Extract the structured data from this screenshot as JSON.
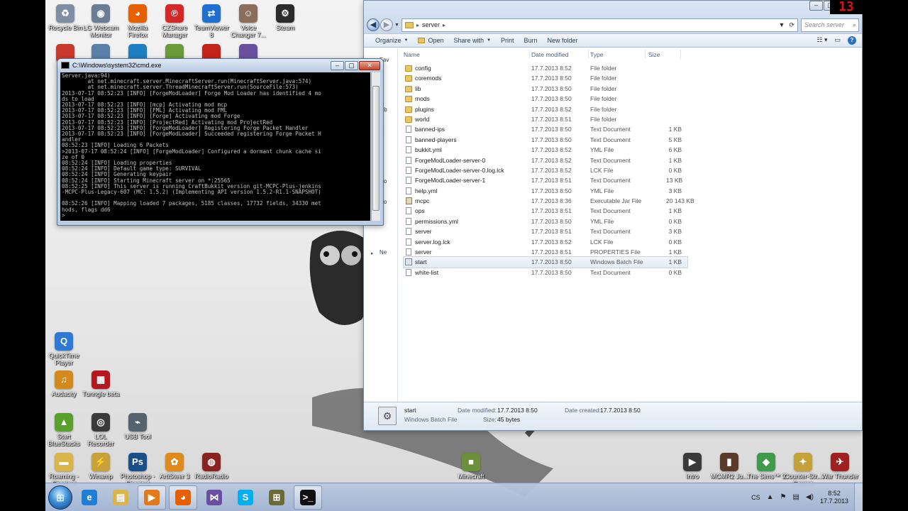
{
  "desktop": {
    "icons_top_row": [
      {
        "label": "Recycle Bin",
        "icon": "recycle-bin-icon",
        "color": "#7f8fa3",
        "glyph": "♻"
      },
      {
        "label": "LG Webcam Monitor",
        "icon": "webcam-icon",
        "color": "#6b7d92",
        "glyph": "◉"
      },
      {
        "label": "Mozilla Firefox",
        "icon": "firefox-icon",
        "color": "#e66000",
        "glyph": "◕"
      },
      {
        "label": "CZShare Manager",
        "icon": "czshare-icon",
        "color": "#d62727",
        "glyph": "℗"
      },
      {
        "label": "TeamViewer 8",
        "icon": "teamviewer-icon",
        "color": "#1f6fd1",
        "glyph": "⇄"
      },
      {
        "label": "Voice Changer 7...",
        "icon": "voice-changer-icon",
        "color": "#8a6d5a",
        "glyph": "☺"
      },
      {
        "label": "Steam",
        "icon": "steam-icon",
        "color": "#2b2b2b",
        "glyph": "⚙"
      }
    ],
    "icons_second_row": [
      {
        "icon": "app-icon-1",
        "color": "#c93a2c"
      },
      {
        "icon": "app-icon-2",
        "color": "#5a7fa8"
      },
      {
        "icon": "app-icon-3",
        "color": "#1f7fc2"
      },
      {
        "icon": "app-icon-4",
        "color": "#6a9a3a"
      },
      {
        "icon": "acrobat-icon",
        "color": "#c4221b"
      },
      {
        "icon": "visual-studio-icon",
        "color": "#6a4fa0"
      }
    ],
    "icons_left": [
      {
        "label": "QuickTime Player",
        "icon": "quicktime-icon",
        "color": "#2d7ad6",
        "glyph": "Q"
      },
      {
        "label": "Audacity",
        "icon": "audacity-icon",
        "color": "#d48a1a",
        "glyph": "♫"
      },
      {
        "label": "Tunngle beta",
        "icon": "tunngle-icon",
        "color": "#b5181e",
        "glyph": "▦"
      },
      {
        "label": "Start BlueStacks",
        "icon": "bluestacks-icon",
        "color": "#5aa02c",
        "glyph": "▲"
      },
      {
        "label": "LOL Recorder",
        "icon": "lol-recorder-icon",
        "color": "#3a3a3a",
        "glyph": "◎"
      },
      {
        "label": "USB Tool",
        "icon": "usb-tool-icon",
        "color": "#55636f",
        "glyph": "⌁"
      },
      {
        "label": "Roaming - Shortcut",
        "icon": "folder-shortcut-icon",
        "color": "#d9b54a",
        "glyph": "▬"
      },
      {
        "label": "Winamp",
        "icon": "winamp-icon",
        "color": "#c7a13a",
        "glyph": "⚡"
      },
      {
        "label": "Photoshop - Shortcut",
        "icon": "photoshop-icon",
        "color": "#1b4f8a",
        "glyph": "Ps"
      },
      {
        "label": "ArtiSteer 3",
        "icon": "artisteer-icon",
        "color": "#e08a1c",
        "glyph": "✿"
      },
      {
        "label": "RadioRadio",
        "icon": "radio-icon",
        "color": "#8a2222",
        "glyph": "◍"
      },
      {
        "label": "Minecraft",
        "icon": "minecraft-icon",
        "color": "#6b8f3a",
        "glyph": "■"
      }
    ],
    "icons_right": [
      {
        "label": "Intro",
        "icon": "intro-icon",
        "color": "#3a3a3a",
        "glyph": "▶"
      },
      {
        "label": "MCMR2 Ju...",
        "icon": "mcmr-icon",
        "color": "#5a3a2a",
        "glyph": "▮"
      },
      {
        "label": "The Sims™ 3",
        "icon": "sims-icon",
        "color": "#3f9b4a",
        "glyph": "◆"
      },
      {
        "label": "Counter-Str... Source",
        "icon": "counter-strike-icon",
        "color": "#c5a13a",
        "glyph": "✦"
      },
      {
        "label": "War Thunder",
        "icon": "war-thunder-icon",
        "color": "#a02020",
        "glyph": "✈"
      }
    ]
  },
  "clock_widget": {
    "value": "13",
    "color": "#dd1111"
  },
  "cmd": {
    "title": "C:\\Windows\\system32\\cmd.exe",
    "lines": [
      "Server.java:94)",
      "        at net.minecraft.server.MinecraftServer.run(MinecraftServer.java:574)",
      "        at net.minecraft.server.ThreadMinecraftServer.run(SourceFile:573)",
      "2013-07-17 08:52:23 [INFO] [ForgeModLoader] Forge Mod Loader has identified 4 mo",
      "ds to load",
      "2013-07-17 08:52:23 [INFO] [mcp] Activating mod mcp",
      "2013-07-17 08:52:23 [INFO] [FML] Activating mod FML",
      "2013-07-17 08:52:23 [INFO] [Forge] Activating mod Forge",
      "2013-07-17 08:52:23 [INFO] [ProjectRed] Activating mod ProjectRed",
      "2013-07-17 08:52:23 [INFO] [ForgeModLoader] Registering Forge Packet Handler",
      "2013-07-17 08:52:23 [INFO] [ForgeModLoader] Succeeded registering Forge Packet H",
      "andler",
      "08:52:23 [INFO] Loading 6 Packets",
      ">2013-07-17 08:52:24 [INFO] [ForgeModLoader] Configured a dormant chunk cache si",
      "ze of 0",
      "08:52:24 [INFO] Loading properties",
      "08:52:24 [INFO] Default game type: SURVIVAL",
      "08:52:24 [INFO] Generating keypair",
      "08:52:24 [INFO] Starting Minecraft server on *:25565",
      "08:52:25 [INFO] This server is running CraftBukkit version git-MCPC-Plus-jenkins",
      "-MCPC-Plus-Legacy-607 (MC: 1.5.2) (Implementing API version 1.5.2-R1.1-SNAPSHOT)",
      "",
      "08:52:26 [INFO] Mapping loaded 7 packages, 5185 classes, 17732 fields, 34330 met",
      "hods, flags dd6",
      ">"
    ]
  },
  "explorer": {
    "breadcrumb": "server",
    "search_placeholder": "Search server",
    "toolbar": {
      "organize": "Organize",
      "open": "Open",
      "share_with": "Share with",
      "print": "Print",
      "burn": "Burn",
      "new_folder": "New folder"
    },
    "nav_pane": [
      "Fav",
      "D",
      "D",
      "R",
      "Lib",
      "D",
      "M",
      "P",
      "V",
      "Ho",
      "Co",
      "L",
      "D",
      "Ne"
    ],
    "columns": {
      "name": "Name",
      "date": "Date modified",
      "type": "Type",
      "size": "Size"
    },
    "files": [
      {
        "name": "config",
        "date": "17.7.2013 8:52",
        "type": "File folder",
        "size": "",
        "kind": "folder"
      },
      {
        "name": "coremods",
        "date": "17.7.2013 8:50",
        "type": "File folder",
        "size": "",
        "kind": "folder"
      },
      {
        "name": "lib",
        "date": "17.7.2013 8:50",
        "type": "File folder",
        "size": "",
        "kind": "folder"
      },
      {
        "name": "mods",
        "date": "17.7.2013 8:50",
        "type": "File folder",
        "size": "",
        "kind": "folder"
      },
      {
        "name": "plugins",
        "date": "17.7.2013 8:52",
        "type": "File folder",
        "size": "",
        "kind": "folder"
      },
      {
        "name": "world",
        "date": "17.7.2013 8:51",
        "type": "File folder",
        "size": "",
        "kind": "folder"
      },
      {
        "name": "banned-ips",
        "date": "17.7.2013 8:50",
        "type": "Text Document",
        "size": "1 KB",
        "kind": "doc"
      },
      {
        "name": "banned-players",
        "date": "17.7.2013 8:50",
        "type": "Text Document",
        "size": "5 KB",
        "kind": "doc"
      },
      {
        "name": "bukkit.yml",
        "date": "17.7.2013 8:52",
        "type": "YML File",
        "size": "6 KB",
        "kind": "doc"
      },
      {
        "name": "ForgeModLoader-server-0",
        "date": "17.7.2013 8:52",
        "type": "Text Document",
        "size": "1 KB",
        "kind": "doc"
      },
      {
        "name": "ForgeModLoader-server-0.log.lck",
        "date": "17.7.2013 8:52",
        "type": "LCK File",
        "size": "0 KB",
        "kind": "doc"
      },
      {
        "name": "ForgeModLoader-server-1",
        "date": "17.7.2013 8:51",
        "type": "Text Document",
        "size": "13 KB",
        "kind": "doc"
      },
      {
        "name": "help.yml",
        "date": "17.7.2013 8:50",
        "type": "YML File",
        "size": "3 KB",
        "kind": "doc"
      },
      {
        "name": "mcpc",
        "date": "17.7.2013 8:36",
        "type": "Executable Jar File",
        "size": "20 143 KB",
        "kind": "jar"
      },
      {
        "name": "ops",
        "date": "17.7.2013 8:51",
        "type": "Text Document",
        "size": "1 KB",
        "kind": "doc"
      },
      {
        "name": "permissions.yml",
        "date": "17.7.2013 8:50",
        "type": "YML File",
        "size": "0 KB",
        "kind": "doc"
      },
      {
        "name": "server",
        "date": "17.7.2013 8:51",
        "type": "Text Document",
        "size": "3 KB",
        "kind": "doc"
      },
      {
        "name": "server.log.lck",
        "date": "17.7.2013 8:52",
        "type": "LCK File",
        "size": "0 KB",
        "kind": "doc"
      },
      {
        "name": "server",
        "date": "17.7.2013 8:51",
        "type": "PROPERTIES File",
        "size": "1 KB",
        "kind": "doc"
      },
      {
        "name": "start",
        "date": "17.7.2013 8:50",
        "type": "Windows Batch File",
        "size": "1 KB",
        "kind": "bat",
        "selected": true
      },
      {
        "name": "white-list",
        "date": "17.7.2013 8:50",
        "type": "Text Document",
        "size": "0 KB",
        "kind": "doc"
      }
    ],
    "details": {
      "name": "start",
      "type": "Windows Batch File",
      "date_modified_label": "Date modified:",
      "date_modified": "17.7.2013 8:50",
      "date_created_label": "Date created:",
      "date_created": "17.7.2013 8:50",
      "size_label": "Size:",
      "size": "45 bytes"
    }
  },
  "taskbar": {
    "pinned": [
      {
        "icon": "ie-icon",
        "color": "#1f7fd6",
        "glyph": "e"
      },
      {
        "icon": "explorer-icon",
        "color": "#d9b54a",
        "glyph": "▤"
      },
      {
        "icon": "media-player-icon",
        "color": "#e07a1a",
        "glyph": "▶"
      },
      {
        "icon": "firefox-taskbar-icon",
        "color": "#e66000",
        "glyph": "◕"
      },
      {
        "icon": "visual-studio-taskbar-icon",
        "color": "#6a4fa0",
        "glyph": "⋈"
      },
      {
        "icon": "skype-icon",
        "color": "#00aff0",
        "glyph": "S"
      },
      {
        "icon": "network-tool-icon",
        "color": "#6b6b3a",
        "glyph": "⊞"
      },
      {
        "icon": "cmd-taskbar-icon",
        "color": "#111111",
        "glyph": ">_"
      }
    ],
    "language": "CS",
    "time": "8:52",
    "date": "17.7.2013"
  }
}
